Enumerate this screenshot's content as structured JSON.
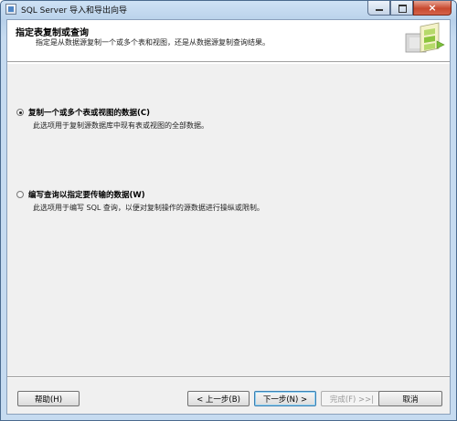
{
  "window": {
    "title": "SQL Server 导入和导出向导",
    "close_glyph": "×"
  },
  "header": {
    "title": "指定表复制或查询",
    "subtitle": "指定是从数据源复制一个或多个表和视图，还是从数据源复制查询结果。"
  },
  "options": [
    {
      "label": "复制一个或多个表或视图的数据(C)",
      "description": "此选项用于复制源数据库中现有表或视图的全部数据。",
      "selected": true
    },
    {
      "label": "编写查询以指定要传输的数据(W)",
      "description": "此选项用于编写 SQL 查询，以便对复制操作的源数据进行操纵或限制。",
      "selected": false
    }
  ],
  "buttons": {
    "help": "帮助(H)",
    "back": "< 上一步(B)",
    "next": "下一步(N) >",
    "finish": "完成(F) >>|",
    "cancel": "取消"
  },
  "colors": {
    "titlebar": "#b9d1ea",
    "close_button": "#c8492f",
    "dialog_body": "#f0f0f0"
  }
}
